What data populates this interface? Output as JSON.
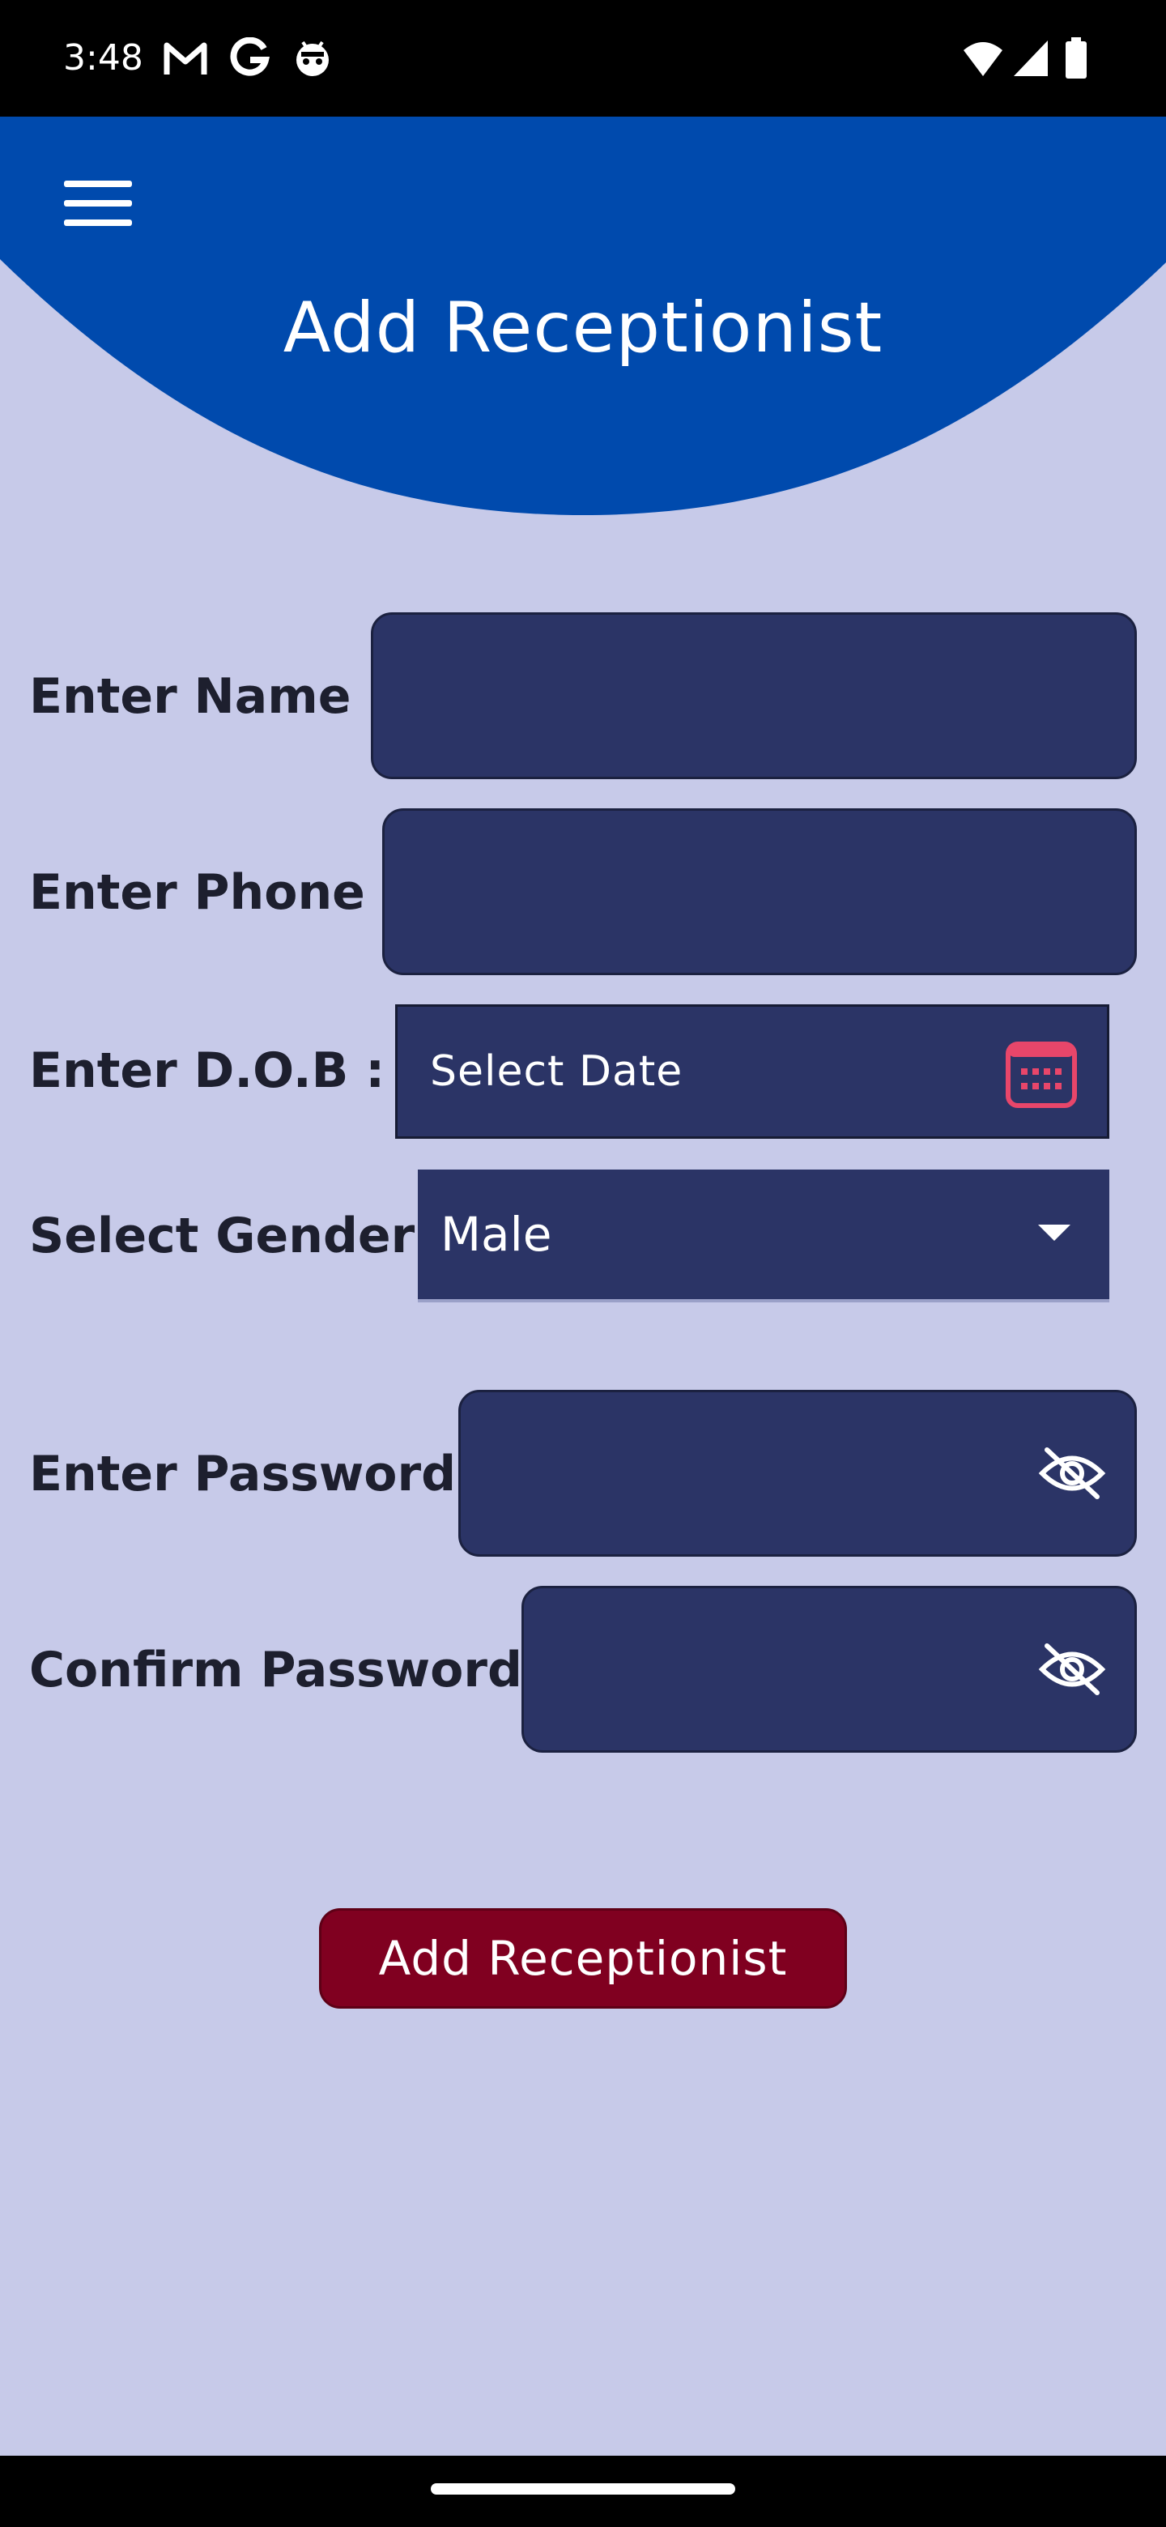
{
  "status_bar": {
    "time": "3:48",
    "left_icons": [
      "gmail-icon",
      "google-icon",
      "android-robot-icon"
    ],
    "right_icons": [
      "wifi-icon",
      "cellular-signal-icon",
      "battery-icon"
    ]
  },
  "header": {
    "title": "Add Receptionist",
    "menu_icon": "hamburger-menu-icon",
    "background_color": "#004aad"
  },
  "form": {
    "name": {
      "label": "Enter Name :",
      "value": ""
    },
    "phone": {
      "label": "Enter Phone :",
      "value": ""
    },
    "dob": {
      "label": "Enter D.O.B :",
      "placeholder": "Select Date",
      "icon": "calendar-icon"
    },
    "gender": {
      "label": "Select Gender :",
      "selected": "Male",
      "icon": "dropdown-arrow-icon"
    },
    "password": {
      "label": "Enter Password :",
      "value": "",
      "icon": "eye-off-icon"
    },
    "confirm_password": {
      "label": "Confirm Password :",
      "value": "",
      "icon": "eye-off-icon"
    },
    "submit_label": "Add Receptionist"
  },
  "colors": {
    "page_background": "#c7cae9",
    "field_background": "#2b3466",
    "button_background": "#800020",
    "calendar_accent": "#e8466a"
  }
}
